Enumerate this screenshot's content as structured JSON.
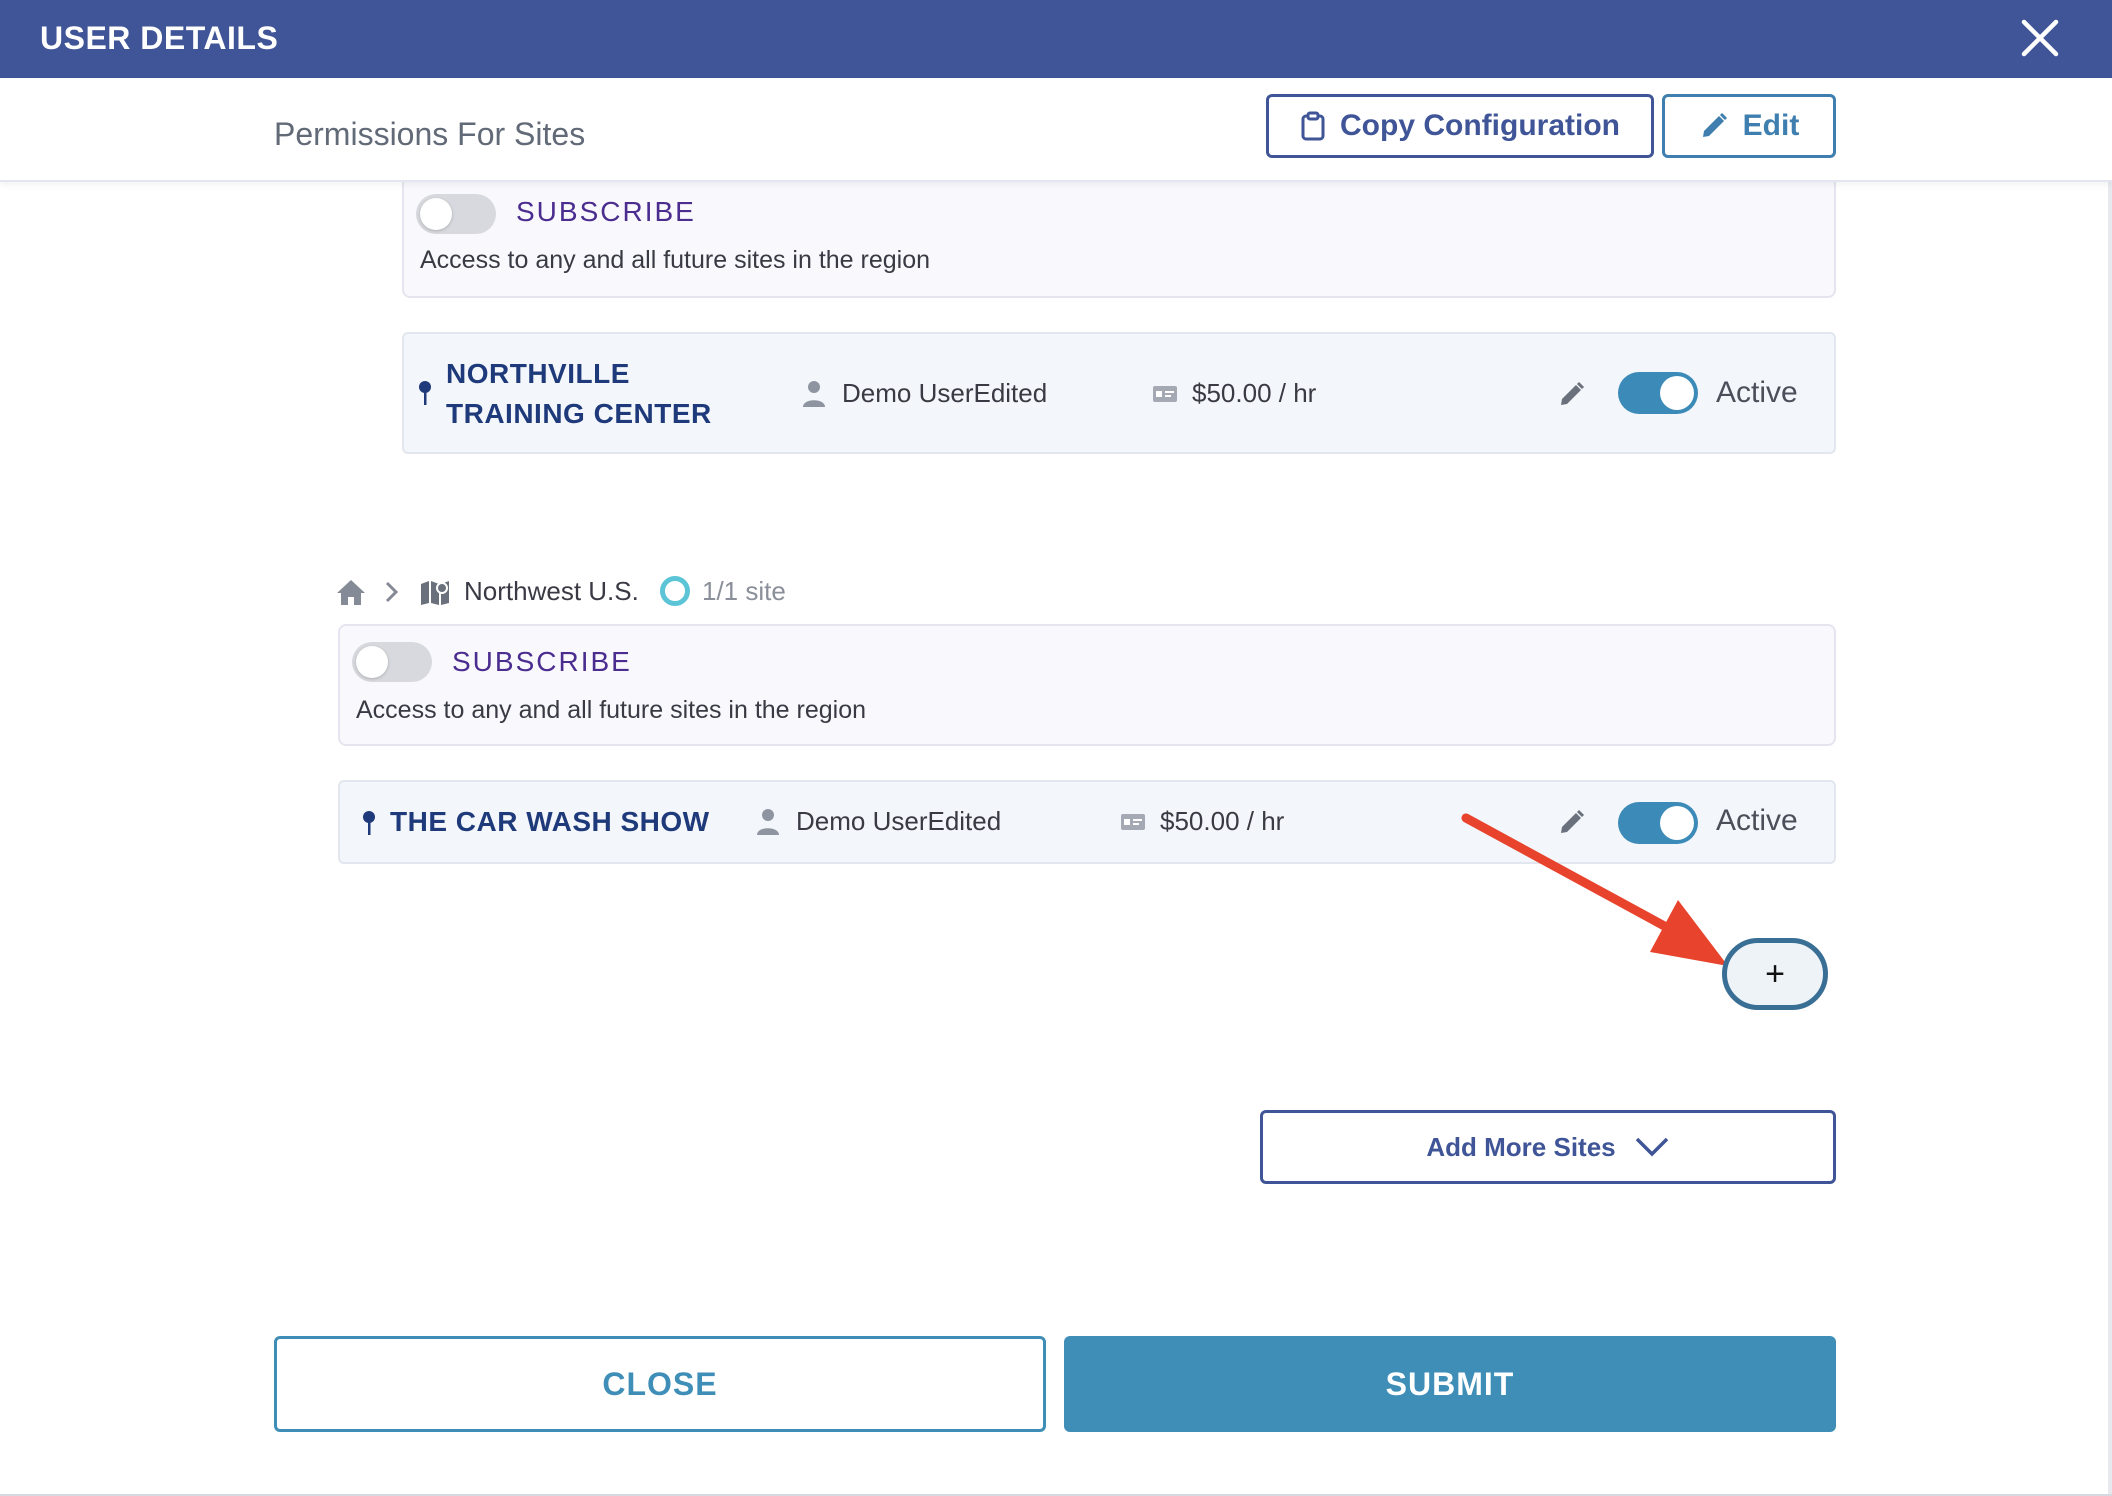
{
  "dialog": {
    "title": "USER DETAILS"
  },
  "header": {
    "section_title": "Permissions For Sites",
    "copy_label": "Copy Configuration",
    "edit_label": "Edit"
  },
  "regions": [
    {
      "subscribe_label": "SUBSCRIBE",
      "subscribe_desc": "Access to any and all future sites in the region",
      "site": {
        "name_line1": "NORTHVILLE",
        "name_line2": "TRAINING CENTER",
        "user": "Demo UserEdited",
        "rate": "$50.00 / hr",
        "status": "Active"
      }
    },
    {
      "breadcrumb": {
        "region": "Northwest U.S.",
        "count": "1/1 site"
      },
      "subscribe_label": "SUBSCRIBE",
      "subscribe_desc": "Access to any and all future sites in the region",
      "site": {
        "name": "THE CAR WASH SHOW",
        "user": "Demo UserEdited",
        "rate": "$50.00 / hr",
        "status": "Active"
      }
    }
  ],
  "add_button": {
    "label": "+"
  },
  "add_more": {
    "label": "Add More Sites"
  },
  "footer": {
    "close_label": "CLOSE",
    "submit_label": "SUBMIT"
  },
  "colors": {
    "header_bg": "#3f5597",
    "accent": "#3f8eb8",
    "toggle_on": "#3b8ab7",
    "annotation_arrow": "#e8432c"
  }
}
